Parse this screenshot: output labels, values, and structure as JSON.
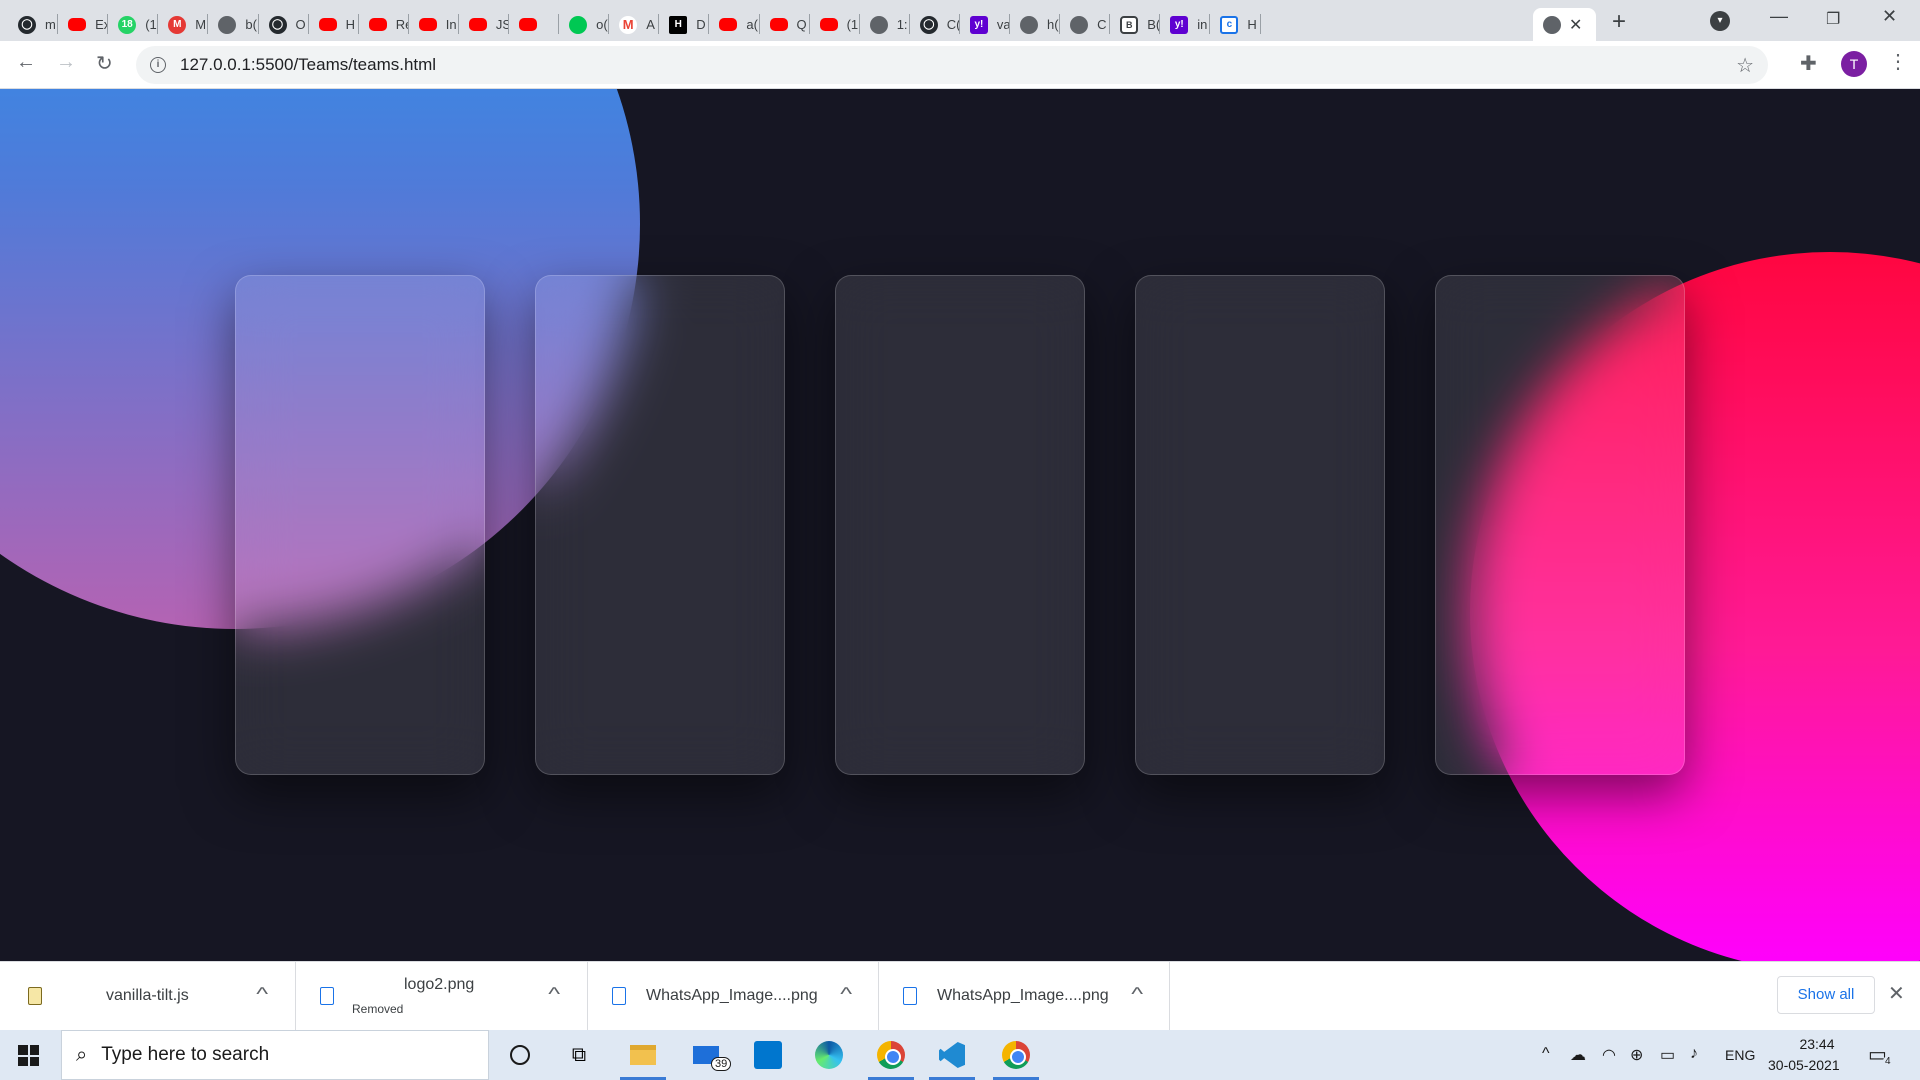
{
  "browser": {
    "tabs": [
      {
        "icon": "github-icon",
        "title": "m"
      },
      {
        "icon": "youtube-icon",
        "title": "Ex"
      },
      {
        "icon": "whatsapp-icon",
        "title": "(1",
        "badge": "18"
      },
      {
        "icon": "mail-icon",
        "title": "M"
      },
      {
        "icon": "globe-icon",
        "title": "b("
      },
      {
        "icon": "github-icon",
        "title": "O"
      },
      {
        "icon": "youtube-icon",
        "title": "H"
      },
      {
        "icon": "youtube-icon",
        "title": "Re"
      },
      {
        "icon": "youtube-icon",
        "title": "In"
      },
      {
        "icon": "youtube-icon",
        "title": "JS"
      },
      {
        "icon": "youtube-icon",
        "title": ""
      },
      {
        "icon": "green-icon",
        "title": "o("
      },
      {
        "icon": "gmail-icon",
        "title": "A"
      },
      {
        "icon": "hackerrank-icon",
        "title": "D"
      },
      {
        "icon": "youtube-icon",
        "title": "a("
      },
      {
        "icon": "youtube-icon",
        "title": "Q"
      },
      {
        "icon": "youtube-icon",
        "title": "(1"
      },
      {
        "icon": "globe-icon",
        "title": "1:"
      },
      {
        "icon": "github-icon",
        "title": "C("
      },
      {
        "icon": "yahoo-icon",
        "title": "va"
      },
      {
        "icon": "globe-icon",
        "title": "h("
      },
      {
        "icon": "globe-icon",
        "title": "C"
      },
      {
        "icon": "shield-icon",
        "title": "B("
      },
      {
        "icon": "yahoo-icon",
        "title": "in"
      },
      {
        "icon": "codepen-icon",
        "title": "H"
      }
    ],
    "active_tab": {
      "icon": "globe-icon",
      "title": ""
    },
    "new_tab_label": "+",
    "url": "127.0.0.1:5500/Teams/teams.html",
    "profile_initial": "T"
  },
  "page": {
    "cards": [
      {
        "id": 1
      },
      {
        "id": 2
      },
      {
        "id": 3
      },
      {
        "id": 4
      },
      {
        "id": 5
      }
    ],
    "colors": {
      "background": "#161623",
      "blue_circle": "#2196f3",
      "pink_circle": "#ff0055"
    }
  },
  "downloads": {
    "items": [
      {
        "name": "vanilla-tilt.js",
        "status": "",
        "kind": "js"
      },
      {
        "name": "logo2.png",
        "status": "Removed",
        "kind": "img"
      },
      {
        "name": "WhatsApp_Image....png",
        "status": "",
        "kind": "img"
      },
      {
        "name": "WhatsApp_Image....png",
        "status": "",
        "kind": "img"
      }
    ],
    "show_all_label": "Show all"
  },
  "taskbar": {
    "search_placeholder": "Type here to search",
    "mail_badge": "39",
    "language": "ENG",
    "time": "23:44",
    "date": "30-05-2021",
    "notification_count": "4"
  }
}
